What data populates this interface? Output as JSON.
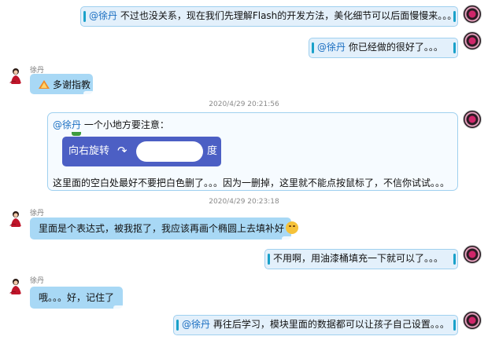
{
  "messages": {
    "m1": {
      "mention": "@徐丹",
      "text": " 不过也没关系，现在我们先理解Flash的开发方法，美化细节可以后面慢慢来。。。"
    },
    "m2": {
      "mention": "@徐丹",
      "text": " 你已经做的很好了。。。"
    },
    "m3": {
      "sender": "徐丹",
      "text": "多谢指教"
    },
    "ts1": "2020/4/29 20:21:56",
    "m4": {
      "mention": "@徐丹",
      "line1": " 一个小地方要注意：",
      "block_left": "向右旋转",
      "block_arrow": "↷",
      "block_right": "度",
      "line2": "这里面的空白处最好不要把白色删了。。。因为一删掉，这里就不能点按鼠标了，不信你试试。。。"
    },
    "ts2": "2020/4/29 20:23:18",
    "m5": {
      "sender": "徐丹",
      "text": "里面是个表达式，被我抠了，我应该再画个椭圆上去填补好"
    },
    "m6": {
      "text": "不用啊，用油漆桶填充一下就可以了。。。"
    },
    "m7": {
      "sender": "徐丹",
      "text": "哦。。。好，记住了"
    },
    "m8": {
      "mention": "@徐丹",
      "text": " 再往后学习，模块里面的数据都可以让孩子自己设置。。。"
    }
  },
  "colors": {
    "outgoing_bubble": "#e3f0fb",
    "outgoing_border": "#9fd0ef",
    "incoming_bubble": "#a8d8f5",
    "mention": "#1b6fc2",
    "scratch_block": "#4c5fc4"
  },
  "icons": [
    "avatar-self",
    "avatar-xudan",
    "thumbs-up-icon",
    "smile-emoji-icon",
    "rotate-right-icon"
  ]
}
